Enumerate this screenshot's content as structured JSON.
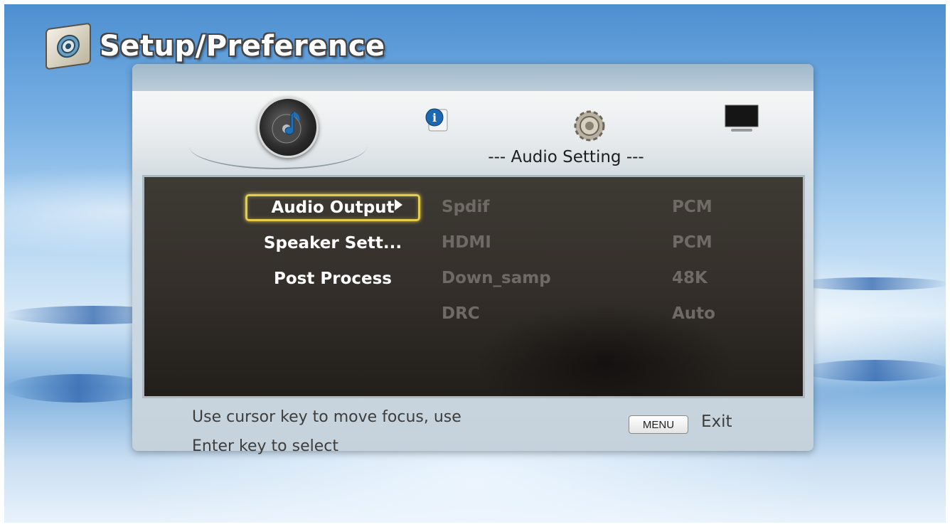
{
  "header": {
    "title": "Setup/Preference",
    "icon": "setup-gear-icon"
  },
  "tabs": [
    {
      "name": "audio",
      "icon": "audio-disc-note-icon",
      "active": true
    },
    {
      "name": "info",
      "icon": "info-icon",
      "active": false
    },
    {
      "name": "system",
      "icon": "gear-icon",
      "active": false
    },
    {
      "name": "video",
      "icon": "tv-screen-icon",
      "active": false
    }
  ],
  "section": {
    "heading": "--- Audio Setting ---"
  },
  "menu": {
    "items": [
      {
        "label": "Audio Output",
        "selected": true
      },
      {
        "label": "Speaker Sett...",
        "selected": false
      },
      {
        "label": "Post Process",
        "selected": false
      }
    ]
  },
  "options": [
    {
      "name": "Spdif",
      "value": "PCM"
    },
    {
      "name": "HDMI",
      "value": "PCM"
    },
    {
      "name": "Down_samp",
      "value": "48K"
    },
    {
      "name": "DRC",
      "value": "Auto"
    }
  ],
  "footer": {
    "help_line1": "Use cursor key to move focus, use",
    "help_line2": "Enter key to select",
    "menu_key": "MENU",
    "exit_label": "Exit"
  },
  "colors": {
    "selection_border": "#e4cd4a",
    "option_text": "#6f6a66",
    "content_bg": "#342f2a"
  }
}
